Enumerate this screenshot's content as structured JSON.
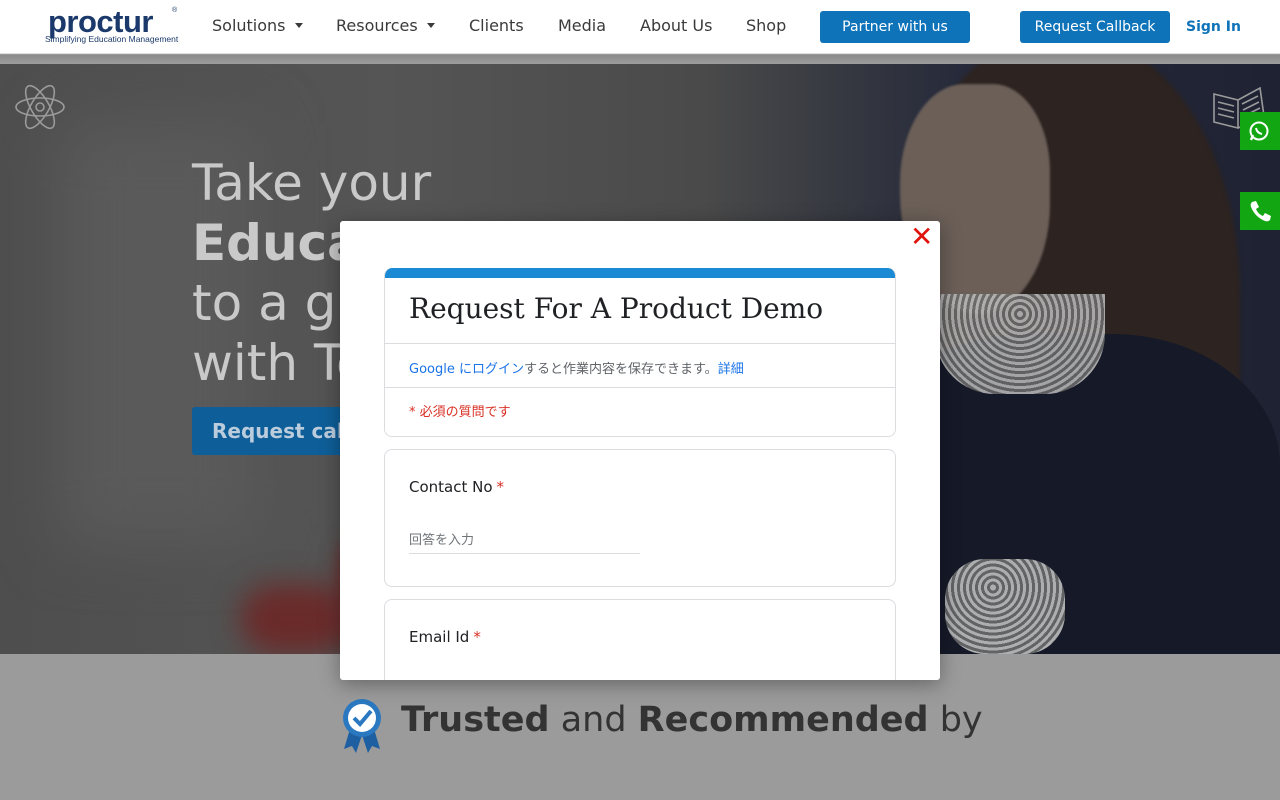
{
  "nav": {
    "logo_word": "proctur",
    "logo_tagline": "Simplifying Education Management",
    "items": [
      "Solutions",
      "Resources",
      "Clients",
      "Media",
      "About Us",
      "Shop"
    ],
    "partner_btn": "Partner with us",
    "callback_btn": "Request Callback",
    "signin": "Sign In"
  },
  "hero": {
    "line1": "Take your",
    "line2": "Educa",
    "line3": "to a g",
    "line4": "with Te",
    "cta": "Request call"
  },
  "trusted": {
    "bold1": "Trusted",
    "plain1": " and ",
    "bold2": "Recommended",
    "plain2": " by"
  },
  "modal": {
    "close": "✕",
    "form_title": "Request For A Product Demo",
    "login_link": "Google にログイン",
    "login_text": "すると作業内容を保存できます。",
    "login_detail": "詳細",
    "required_note": "* 必須の質問です",
    "questions": [
      {
        "label": "Contact No",
        "star": "*",
        "placeholder": "回答を入力"
      },
      {
        "label": "Email Id",
        "star": "*"
      }
    ]
  },
  "colors": {
    "brand_blue": "#0e73b9",
    "form_accent": "#1a8ad4",
    "required_red": "#d93025",
    "close_red": "#e0140d",
    "whatsapp_green": "#13a613"
  }
}
